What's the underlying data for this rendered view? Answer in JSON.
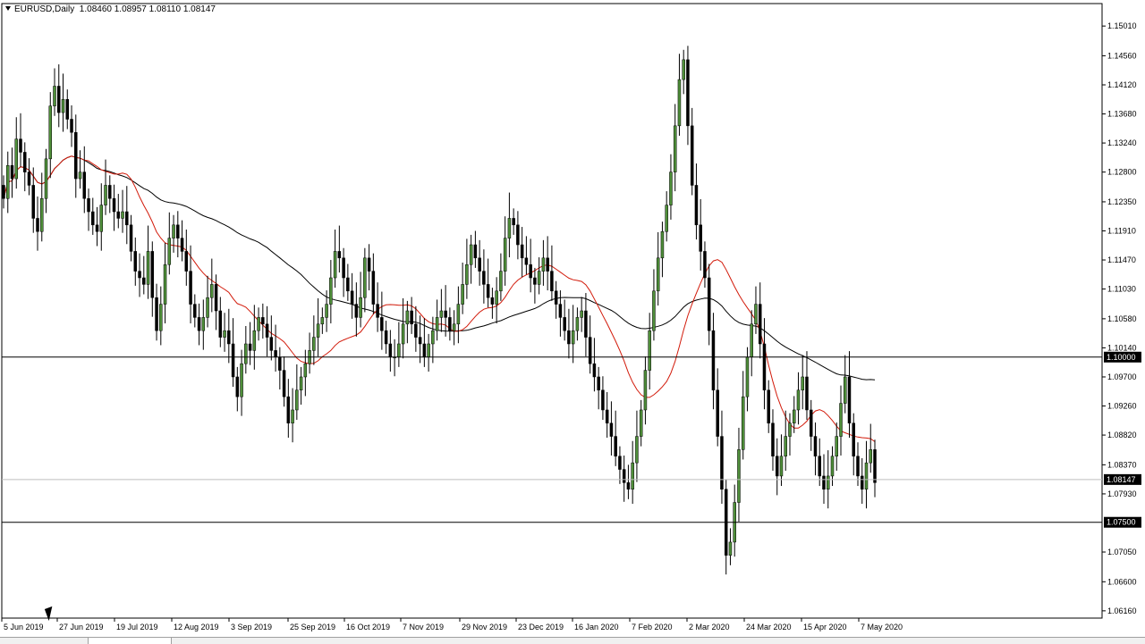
{
  "header": {
    "symbol": "EURUSD,Daily",
    "ohlc": "1.08460 1.08957 1.08110 1.08147"
  },
  "colors": {
    "up_candle": "#4f8f3a",
    "down_candle": "#000000",
    "ma_fast": "#d21a0a",
    "ma_slow": "#000000",
    "tag_bg": "#000000"
  },
  "price_axis": {
    "ticks": [
      "1.15010",
      "1.14560",
      "1.14120",
      "1.13680",
      "1.13240",
      "1.12800",
      "1.12350",
      "1.11910",
      "1.11470",
      "1.11030",
      "1.10580",
      "1.10140",
      "1.09700",
      "1.09260",
      "1.08820",
      "1.08370",
      "1.07930",
      "1.07050",
      "1.06600",
      "1.06160"
    ],
    "tags": [
      {
        "value": "1.10000",
        "label": "1.10000"
      },
      {
        "value": "1.08147",
        "label": "1.08147"
      },
      {
        "value": "1.07500",
        "label": "1.07500"
      }
    ]
  },
  "time_axis": {
    "labels": [
      "5 Jun 2019",
      "27 Jun 2019",
      "19 Jul 2019",
      "12 Aug 2019",
      "3 Sep 2019",
      "25 Sep 2019",
      "16 Oct 2019",
      "7 Nov 2019",
      "29 Nov 2019",
      "23 Dec 2019",
      "16 Jan 2020",
      "7 Feb 2020",
      "2 Mar 2020",
      "24 Mar 2020",
      "15 Apr 2020",
      "7 May 2020"
    ]
  },
  "chart_data": {
    "type": "candlestick",
    "title": "EURUSD,Daily",
    "ylim": [
      1.0605,
      1.1535
    ],
    "horizontal_levels": [
      1.1,
      1.075
    ],
    "current_price": 1.08147,
    "series_close": [
      1.124,
      1.129,
      1.127,
      1.133,
      1.131,
      1.128,
      1.126,
      1.121,
      1.119,
      1.124,
      1.13,
      1.138,
      1.141,
      1.137,
      1.139,
      1.136,
      1.134,
      1.127,
      1.128,
      1.124,
      1.122,
      1.12,
      1.119,
      1.123,
      1.126,
      1.124,
      1.122,
      1.121,
      1.122,
      1.12,
      1.116,
      1.113,
      1.112,
      1.111,
      1.116,
      1.109,
      1.104,
      1.108,
      1.114,
      1.118,
      1.12,
      1.118,
      1.116,
      1.113,
      1.108,
      1.106,
      1.104,
      1.106,
      1.109,
      1.111,
      1.107,
      1.103,
      1.104,
      1.102,
      1.097,
      1.094,
      1.099,
      1.102,
      1.101,
      1.104,
      1.106,
      1.105,
      1.103,
      1.101,
      1.1,
      1.098,
      1.094,
      1.09,
      1.092,
      1.095,
      1.097,
      1.099,
      1.101,
      1.103,
      1.105,
      1.106,
      1.108,
      1.112,
      1.116,
      1.115,
      1.112,
      1.11,
      1.108,
      1.106,
      1.109,
      1.115,
      1.113,
      1.108,
      1.106,
      1.104,
      1.102,
      1.1,
      1.1,
      1.102,
      1.105,
      1.107,
      1.105,
      1.103,
      1.102,
      1.1,
      1.102,
      1.104,
      1.106,
      1.107,
      1.106,
      1.104,
      1.105,
      1.108,
      1.111,
      1.114,
      1.117,
      1.115,
      1.113,
      1.111,
      1.109,
      1.108,
      1.11,
      1.113,
      1.118,
      1.121,
      1.12,
      1.117,
      1.115,
      1.114,
      1.112,
      1.111,
      1.113,
      1.115,
      1.113,
      1.11,
      1.108,
      1.106,
      1.104,
      1.102,
      1.104,
      1.106,
      1.107,
      1.103,
      1.099,
      1.097,
      1.095,
      1.092,
      1.09,
      1.088,
      1.085,
      1.083,
      1.081,
      1.08,
      1.084,
      1.088,
      1.092,
      1.098,
      1.104,
      1.11,
      1.115,
      1.119,
      1.123,
      1.128,
      1.135,
      1.142,
      1.145,
      1.135,
      1.126,
      1.12,
      1.116,
      1.112,
      1.104,
      1.095,
      1.088,
      1.08,
      1.07,
      1.072,
      1.078,
      1.086,
      1.094,
      1.1,
      1.105,
      1.108,
      1.102,
      1.095,
      1.09,
      1.085,
      1.082,
      1.085,
      1.088,
      1.09,
      1.092,
      1.095,
      1.097,
      1.092,
      1.088,
      1.085,
      1.082,
      1.08,
      1.082,
      1.085,
      1.088,
      1.093,
      1.097,
      1.09,
      1.085,
      1.082,
      1.08,
      1.084,
      1.086,
      1.081
    ]
  }
}
